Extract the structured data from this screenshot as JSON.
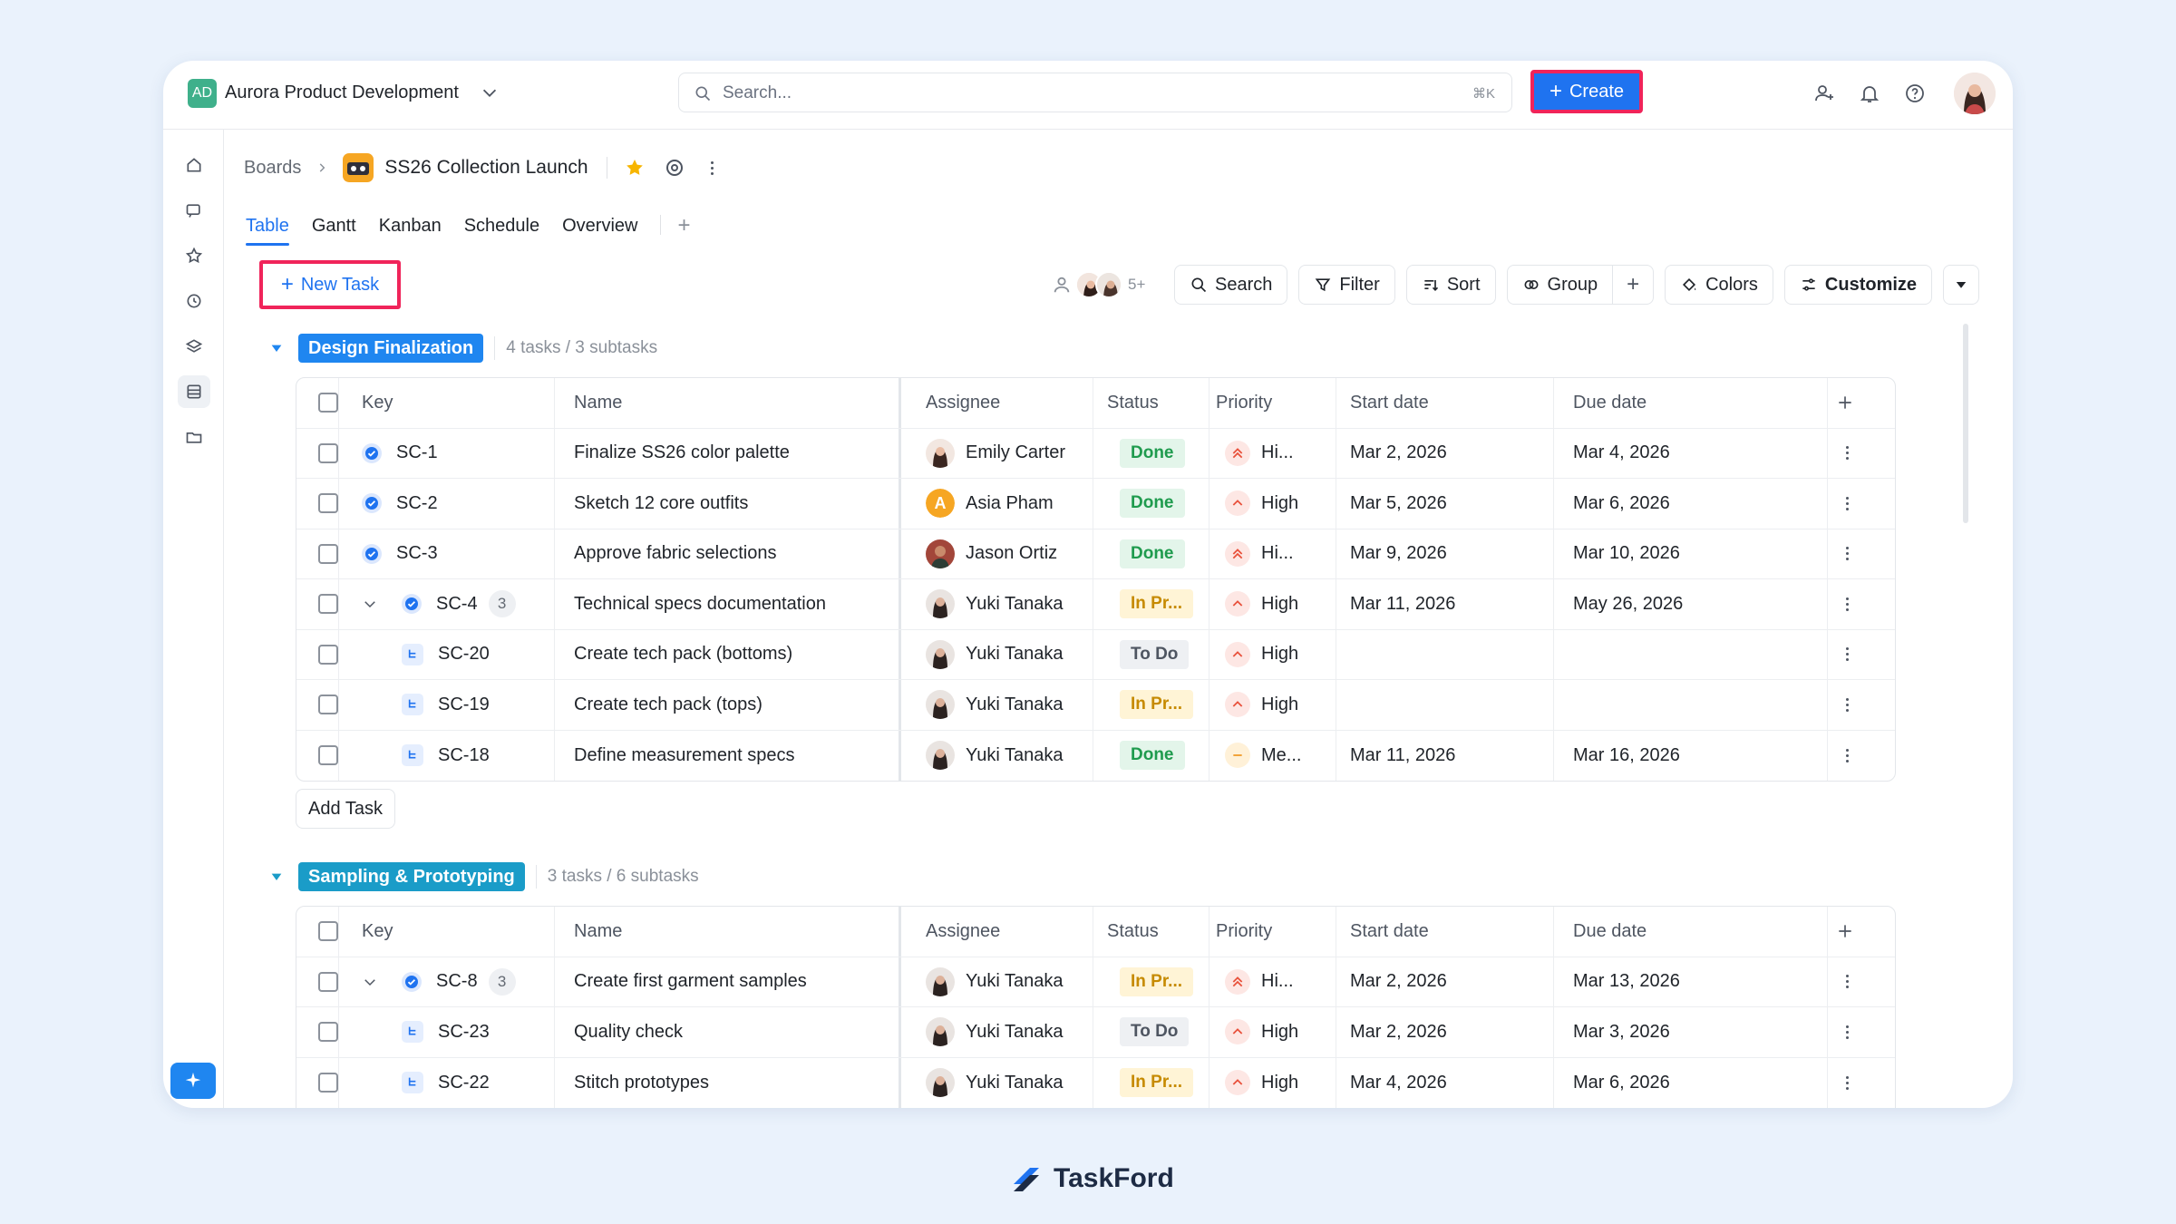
{
  "topbar": {
    "workspace_initials": "AD",
    "workspace_name": "Aurora Product Development",
    "search_placeholder": "Search...",
    "search_shortcut": "⌘K",
    "create_label": "Create"
  },
  "breadcrumb": {
    "root": "Boards",
    "project": "SS26 Collection Launch"
  },
  "tabs": [
    "Table",
    "Gantt",
    "Kanban",
    "Schedule",
    "Overview"
  ],
  "toolbar": {
    "new_task": "New Task",
    "members_more": "5+",
    "search": "Search",
    "filter": "Filter",
    "sort": "Sort",
    "group": "Group",
    "colors": "Colors",
    "customize": "Customize"
  },
  "columns": {
    "key": "Key",
    "name": "Name",
    "assignee": "Assignee",
    "status": "Status",
    "priority": "Priority",
    "start": "Start date",
    "due": "Due date"
  },
  "colors": {
    "accent": "#1f73f0",
    "highlight": "#f0245a",
    "group1": "#1f86f0",
    "group2": "#1a9cc8"
  },
  "groups": [
    {
      "label": "Design Finalization",
      "count": "4 tasks / 3 subtasks",
      "rows": [
        {
          "key": "SC-1",
          "name": "Finalize SS26 color palette",
          "assignee": "Emily Carter",
          "status": "Done",
          "priority": "Hi...",
          "start": "Mar 2, 2026",
          "due": "Mar 4, 2026"
        },
        {
          "key": "SC-2",
          "name": "Sketch 12 core outfits",
          "assignee": "Asia Pham",
          "status": "Done",
          "priority": "High",
          "start": "Mar 5, 2026",
          "due": "Mar 6, 2026"
        },
        {
          "key": "SC-3",
          "name": "Approve fabric selections",
          "assignee": "Jason Ortiz",
          "status": "Done",
          "priority": "Hi...",
          "start": "Mar 9, 2026",
          "due": "Mar 10, 2026"
        },
        {
          "key": "SC-4",
          "subcount": "3",
          "name": "Technical specs documentation",
          "assignee": "Yuki Tanaka",
          "status": "In Pr...",
          "priority": "High",
          "start": "Mar 11, 2026",
          "due": "May 26, 2026"
        },
        {
          "key": "SC-20",
          "name": "Create tech pack (bottoms)",
          "assignee": "Yuki Tanaka",
          "status": "To Do",
          "priority": "High",
          "start": "",
          "due": ""
        },
        {
          "key": "SC-19",
          "name": "Create tech pack (tops)",
          "assignee": "Yuki Tanaka",
          "status": "In Pr...",
          "priority": "High",
          "start": "",
          "due": ""
        },
        {
          "key": "SC-18",
          "name": "Define measurement specs",
          "assignee": "Yuki Tanaka",
          "status": "Done",
          "priority": "Me...",
          "start": "Mar 11, 2026",
          "due": "Mar 16, 2026"
        }
      ]
    },
    {
      "label": "Sampling & Prototyping",
      "count": "3 tasks / 6 subtasks",
      "rows": [
        {
          "key": "SC-8",
          "subcount": "3",
          "name": "Create first garment samples",
          "assignee": "Yuki Tanaka",
          "status": "In Pr...",
          "priority": "Hi...",
          "start": "Mar 2, 2026",
          "due": "Mar 13, 2026"
        },
        {
          "key": "SC-23",
          "name": "Quality check",
          "assignee": "Yuki Tanaka",
          "status": "To Do",
          "priority": "High",
          "start": "Mar 2, 2026",
          "due": "Mar 3, 2026"
        },
        {
          "key": "SC-22",
          "name": "Stitch prototypes",
          "assignee": "Yuki Tanaka",
          "status": "In Pr...",
          "priority": "High",
          "start": "Mar 4, 2026",
          "due": "Mar 6, 2026"
        }
      ]
    }
  ],
  "add_task": "Add Task",
  "footer": {
    "brand": "TaskFord"
  }
}
